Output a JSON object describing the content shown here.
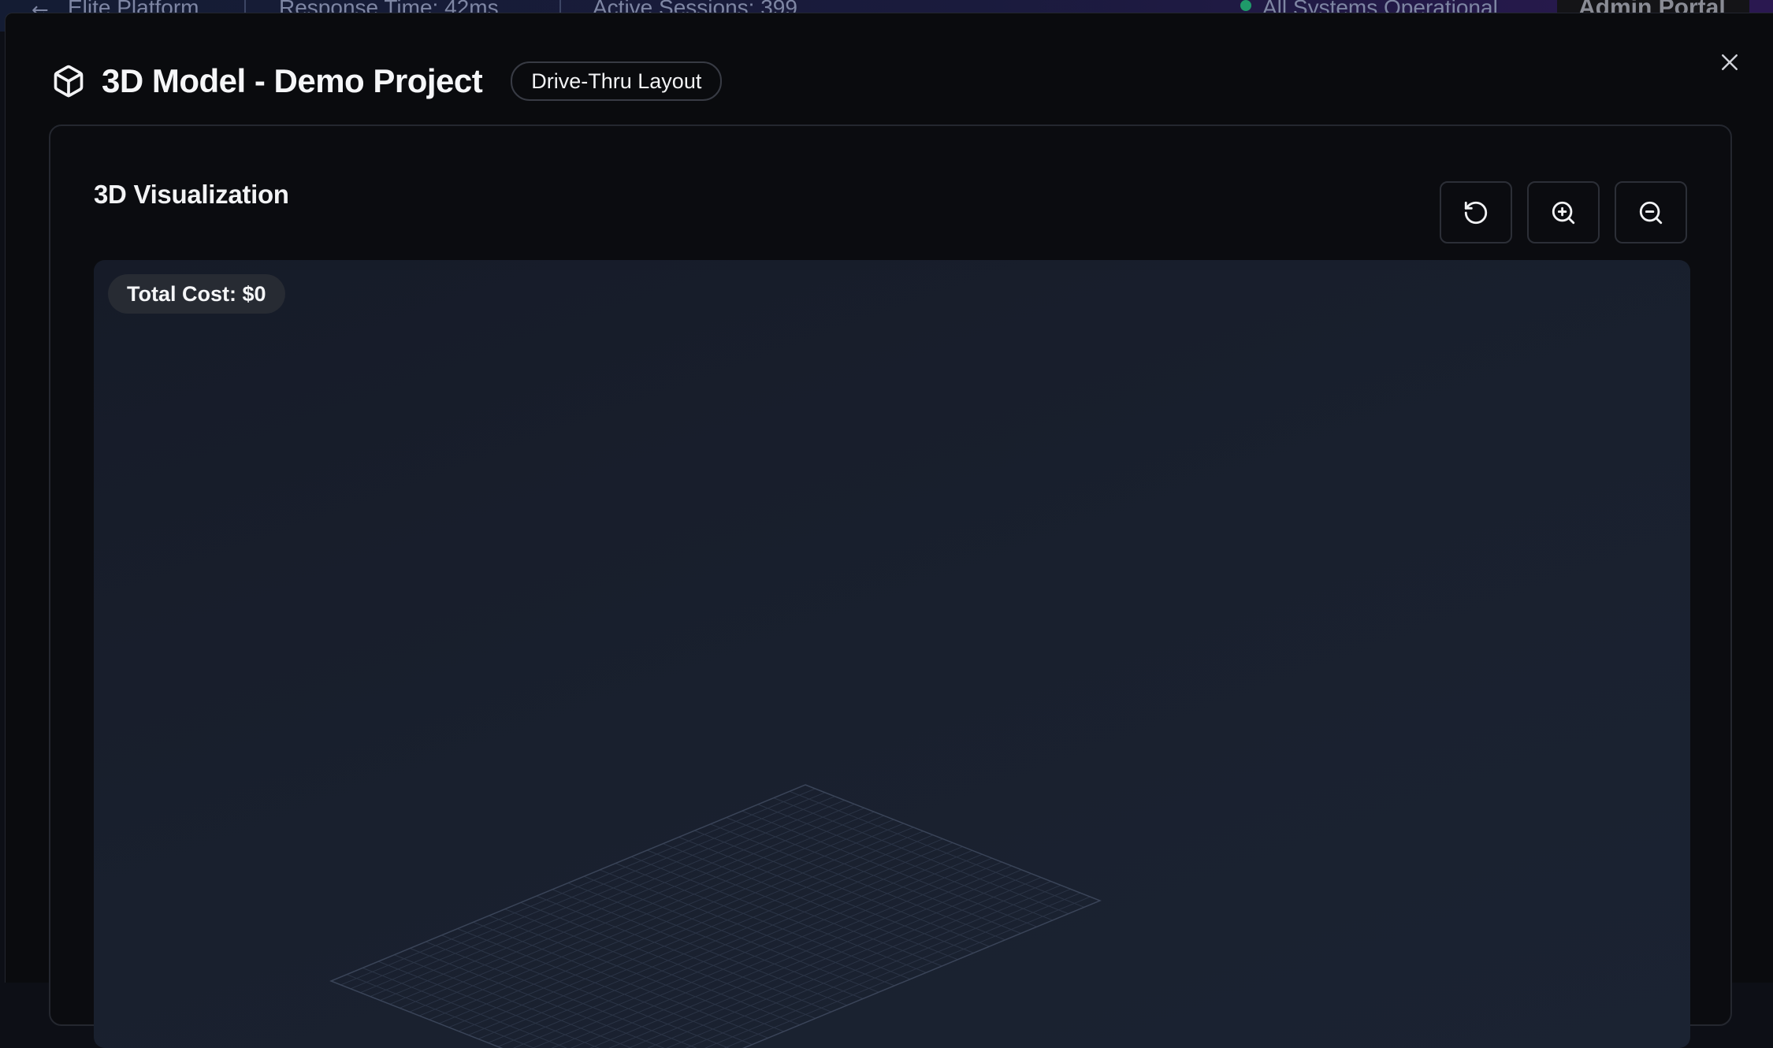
{
  "background_bar": {
    "brand_label": "Elite Platform",
    "response_time": "Response Time: 42ms",
    "active_sessions": "Active Sessions: 399",
    "system_status": "All Systems Operational",
    "admin_label": "Admin Portal"
  },
  "modal": {
    "icon": "cube-icon",
    "title": "3D Model - Demo Project",
    "badge": "Drive-Thru Layout",
    "close_icon": "close-icon"
  },
  "visualization": {
    "title": "3D Visualization",
    "controls": [
      {
        "icon": "rotate-reset-icon"
      },
      {
        "icon": "zoom-in-icon"
      },
      {
        "icon": "zoom-out-icon"
      }
    ],
    "total_cost": "Total Cost: $0"
  },
  "colors": {
    "modal_background": "#0a0b0e",
    "viewport_background": "#19202e",
    "grid_line": "#2b3446",
    "text_primary": "#f2f3f5",
    "status_green": "#1f9a6a"
  }
}
